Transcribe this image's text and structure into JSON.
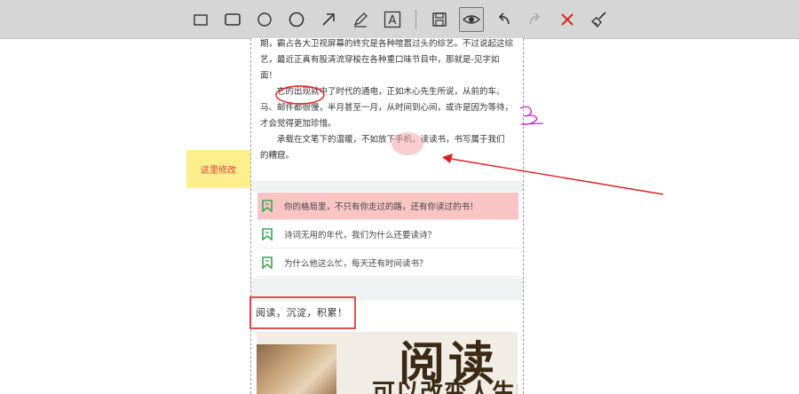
{
  "toolbar": {
    "tools": [
      {
        "name": "rectangle-outline-tool",
        "icon": "rectangle-outline-icon"
      },
      {
        "name": "rectangle-tool",
        "icon": "rectangle-icon"
      },
      {
        "name": "ellipse-outline-tool",
        "icon": "ellipse-outline-icon"
      },
      {
        "name": "ellipse-tool",
        "icon": "ellipse-icon"
      },
      {
        "name": "arrow-tool",
        "icon": "arrow-icon"
      },
      {
        "name": "pencil-tool",
        "icon": "pencil-icon"
      },
      {
        "name": "text-tool",
        "icon": "text-icon",
        "label": "A"
      },
      {
        "name": "save-tool",
        "icon": "save-icon"
      },
      {
        "name": "preview-tool",
        "icon": "eye-icon",
        "active": true
      },
      {
        "name": "undo-tool",
        "icon": "undo-icon"
      },
      {
        "name": "redo-tool",
        "icon": "redo-icon"
      },
      {
        "name": "close-tool",
        "icon": "close-icon"
      },
      {
        "name": "clear-tool",
        "icon": "broom-icon"
      }
    ],
    "text_tool_label": "A"
  },
  "article": {
    "line0": "期，霸占各大卫视屏幕的终究是各种喧嚣过头的综艺。不过说起这综",
    "line1": "艺，最近正真有股清流穿梭在各种重口味节目中，那就是-见字如",
    "line2": "面！",
    "para2_a": "它的出现就",
    "para2_b": "中了时代的通电，正如木心先生所说，从前的车、",
    "para2_c": "马、邮件都很慢，半月甚至一月，从时间到心间，或许是因为等待，",
    "para2_d": "才会觉得更加珍惜。",
    "para3_a": "承载在文笔下的温暖，不如放",
    "para3_b": "下手机",
    "para3_c": "，读读书，书写属于我们",
    "para3_d": "的糟窟。"
  },
  "sticky_note": "这里修改",
  "list": [
    {
      "text": "你的格局里，不只有你走过的路，还有你读过的书！",
      "highlighted": true
    },
    {
      "text": "诗词无用的年代，我们为什么还要读诗？",
      "highlighted": false
    },
    {
      "text": "为什么他这么忙，每天还有时间读书？",
      "highlighted": false
    }
  ],
  "section_title": "阅读，沉淀，积累！",
  "banner": {
    "big_text": "阅读",
    "sub_text": "可以改变人生的"
  },
  "colors": {
    "toolbar_bg": "#d6d6d6",
    "annotation_red": "#e02020",
    "highlight_pink": "#f9c4c4",
    "sticky_yellow": "#fdef8c",
    "bookmark_green": "#3aa655",
    "pencil_magenta": "#d020d0",
    "close_red": "#e02020"
  }
}
